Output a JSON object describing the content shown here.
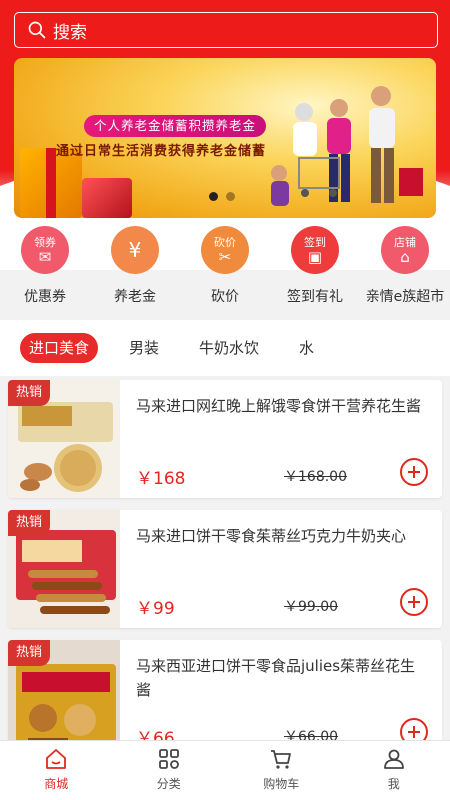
{
  "search": {
    "placeholder": "搜索"
  },
  "banner": {
    "headline": "个人养老金储蓄积攒养老金",
    "subline": "通过日常生活消费获得养老金储蓄",
    "slides": 2,
    "active_slide": 1
  },
  "quick_nav": [
    {
      "badge": "领券",
      "label": "优惠券",
      "icon": "coupon-icon",
      "color": "#f05a6a"
    },
    {
      "badge": "",
      "label": "养老金",
      "icon": "money-bag-icon",
      "color": "#f2894a"
    },
    {
      "badge": "砍价",
      "label": "砍价",
      "icon": "bargain-icon",
      "color": "#f08a3c"
    },
    {
      "badge": "签到",
      "label": "签到有礼",
      "icon": "checkin-icon",
      "color": "#ee3b3b"
    },
    {
      "badge": "店铺",
      "label": "亲情e族超市",
      "icon": "store-icon",
      "color": "#f05a6a"
    }
  ],
  "category_tabs": [
    {
      "label": "进口美食",
      "active": true
    },
    {
      "label": "男装",
      "active": false
    },
    {
      "label": "牛奶水饮",
      "active": false
    },
    {
      "label": "水",
      "active": false
    }
  ],
  "products": [
    {
      "tag": "热销",
      "name": "马来进口网红晚上解饿零食饼干营养花生酱",
      "price": "￥168",
      "original_price": "￥168.00"
    },
    {
      "tag": "热销",
      "name": "马来进口饼干零食茱蒂丝巧克力牛奶夹心",
      "price": "￥99",
      "original_price": "￥99.00"
    },
    {
      "tag": "热销",
      "name": "马来西亚进口饼干零食品julies茱蒂丝花生酱",
      "price": "￥66",
      "original_price": "￥66.00"
    }
  ],
  "tabbar": [
    {
      "label": "商城",
      "icon": "home-icon",
      "active": true
    },
    {
      "label": "分类",
      "icon": "category-icon",
      "active": false
    },
    {
      "label": "购物车",
      "icon": "cart-icon",
      "active": false
    },
    {
      "label": "我",
      "icon": "user-icon",
      "active": false
    }
  ],
  "colors": {
    "brand": "#ee1b1b",
    "price": "#e0281f"
  }
}
